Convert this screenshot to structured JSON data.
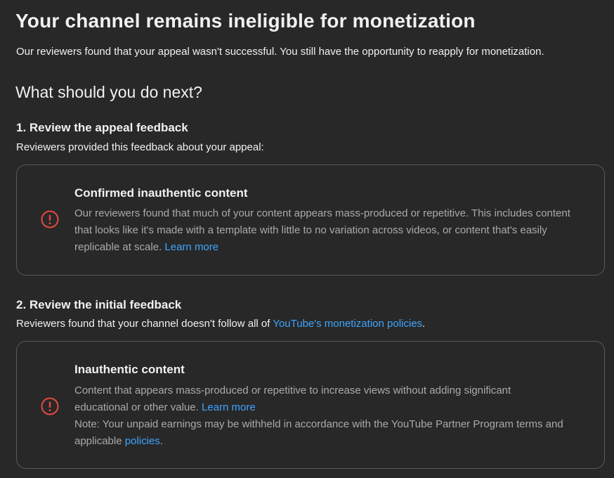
{
  "header": {
    "title": "Your channel remains ineligible for monetization",
    "subtitle": "Our reviewers found that your appeal wasn't successful. You still have the opportunity to reapply for monetization."
  },
  "next": {
    "heading": "What should you do next?"
  },
  "step1": {
    "heading": "1. Review the appeal feedback",
    "desc": "Reviewers provided this feedback about your appeal:",
    "card": {
      "title": "Confirmed inauthentic content",
      "body": "Our reviewers found that much of your content appears mass-produced or repetitive. This includes content that looks like it's made with a template with little to no variation across videos, or content that's easily replicable at scale.",
      "link": "Learn more"
    }
  },
  "step2": {
    "heading": "2. Review the initial feedback",
    "desc_prefix": "Reviewers found that your channel doesn't follow all of ",
    "desc_link": "YouTube's monetization policies",
    "desc_suffix": ".",
    "card": {
      "title": "Inauthentic content",
      "body": "Content that appears mass-produced or repetitive to increase views without adding significant educational or other value.",
      "link": "Learn more",
      "note_prefix": "Note: Your unpaid earnings may be withheld in accordance with the YouTube Partner Program terms and applicable ",
      "note_link": "policies",
      "note_suffix": "."
    }
  },
  "colors": {
    "background": "#282828",
    "text": "#f1f1f1",
    "secondary_text": "#aaaaaa",
    "link": "#3ea6ff",
    "alert_icon": "#e8483f",
    "card_border": "#5a5a5a"
  },
  "icons": {
    "alert": "alert-circle-icon"
  }
}
